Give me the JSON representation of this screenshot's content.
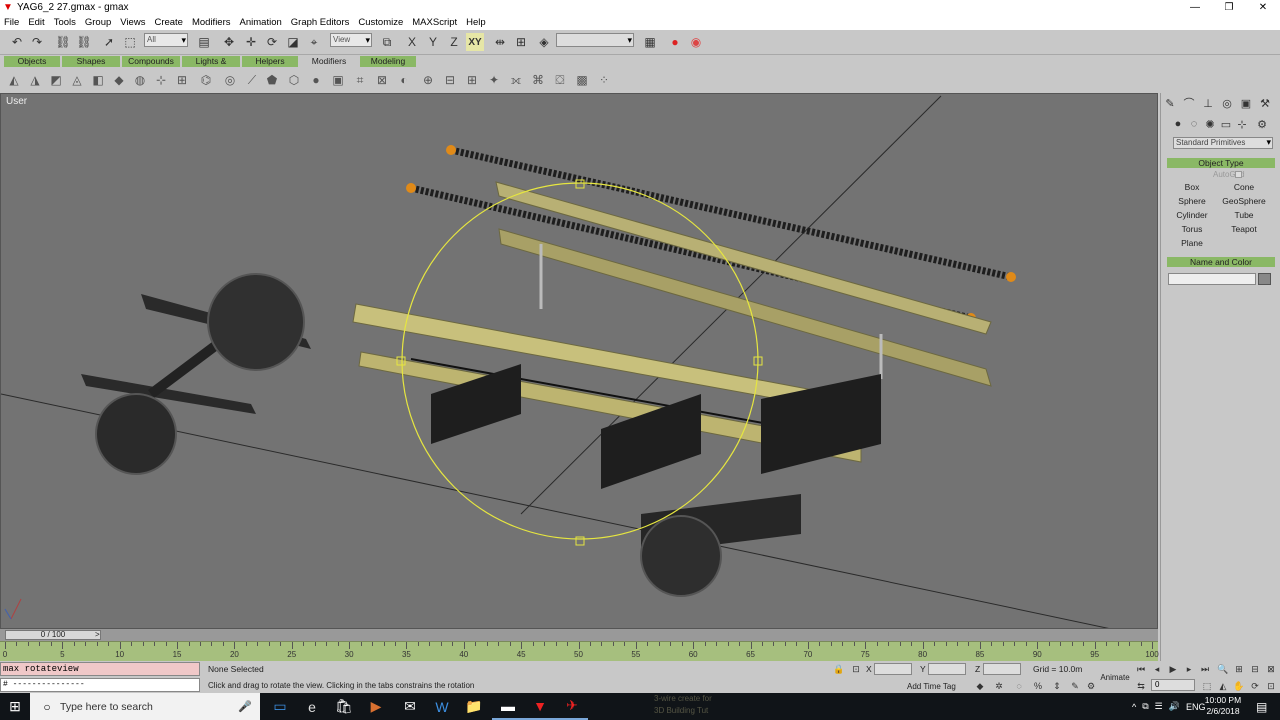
{
  "window": {
    "title": "YAG6_2 27.gmax - gmax",
    "controls": [
      "—",
      "❐",
      "✕"
    ]
  },
  "menu": [
    "File",
    "Edit",
    "Tools",
    "Group",
    "Views",
    "Create",
    "Modifiers",
    "Animation",
    "Graph Editors",
    "Customize",
    "MAXScript",
    "Help"
  ],
  "toolbar": {
    "selection_filter": "All",
    "ref_coord": "View",
    "axis_label": "XY",
    "named_selection": ""
  },
  "tabs": [
    "Objects",
    "Shapes",
    "Compounds",
    "Lights & Cameras",
    "Helpers",
    "Modifiers",
    "Modeling"
  ],
  "viewport": {
    "label": "User"
  },
  "command_panel": {
    "category": "Standard Primitives",
    "object_type_title": "Object Type",
    "autogrid": "AutoGrid",
    "primitives": [
      "Box",
      "Cone",
      "Sphere",
      "GeoSphere",
      "Cylinder",
      "Tube",
      "Torus",
      "Teapot",
      "Plane"
    ],
    "name_color_title": "Name and Color"
  },
  "time_slider": {
    "label": "0 / 100"
  },
  "trackbar": {
    "labels": [
      "0",
      "5",
      "10",
      "15",
      "20",
      "25",
      "30",
      "35",
      "40",
      "45",
      "50",
      "55",
      "60",
      "65",
      "70",
      "75",
      "80",
      "85",
      "90",
      "95",
      "100"
    ]
  },
  "status": {
    "listener_line1": "max rotateview",
    "listener_line2": "# ---------------",
    "selection": "None Selected",
    "prompt": "Click and drag to rotate the view.  Clicking in the tabs constrains the rotation",
    "x_label": "X",
    "y_label": "Y",
    "z_label": "Z",
    "grid": "Grid = 10.0m",
    "add_time_tag": "Add Time Tag",
    "animate": "Animate",
    "frame": "0"
  },
  "taskbar": {
    "search_placeholder": "Type here to search",
    "ghost_line1": "3-wire create for",
    "ghost_line2": "3D Building Tut",
    "language": "ENG",
    "time": "10:00 PM",
    "date": "2/6/2018"
  }
}
